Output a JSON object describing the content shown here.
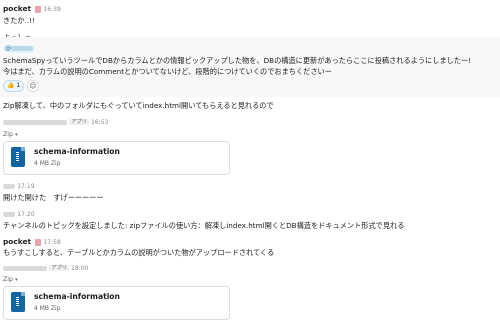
{
  "messages": {
    "m1": {
      "name": "pocket",
      "time": "16:39",
      "text": "きたか..!!"
    },
    "m2": {
      "text": "よっしゃ"
    },
    "m3": {
      "mention": "@",
      "line1": "SchemaSpyっていうツールでDBからカラムとかの情報ピックアップした物を、DBの構造に更新があったらここに投稿されるようにしましたー!",
      "line2": "今はまだ、カラムの説明のCommentとかついてないけど、段階的につけていくのでおまちくださいー",
      "reaction_emoji": "👍",
      "reaction_count": "1",
      "add_reaction_icon": "☺"
    },
    "m4": {
      "text": "Zip解凍して、中のフォルダにもぐっていてindex.html開いてもらえると見れるので"
    },
    "m5": {
      "badge": "アプリ",
      "time": "16:53",
      "zip": "Zip",
      "caret": "▾",
      "file_name": "schema-information",
      "file_meta": "4 MB Zip"
    },
    "m6": {
      "time": "17:19",
      "text": "開けた開けた　すげーーーーー"
    },
    "m7": {
      "time": "17:20",
      "text": "チャンネルのトピックを設定しました: zipファイルの使い方：解凍しindex.html開くとDB構造をドキュメント形式で見れる"
    },
    "m8": {
      "name": "pocket",
      "time": "17:58",
      "text": "もうすこしすると、テーブルとかカラムの説明がついた物がアップロードされてくる"
    },
    "m9": {
      "badge": "アプリ",
      "time": "18:00",
      "zip": "Zip",
      "caret": "▾",
      "file_name": "schema-information",
      "file_meta": "4 MB Zip"
    }
  }
}
